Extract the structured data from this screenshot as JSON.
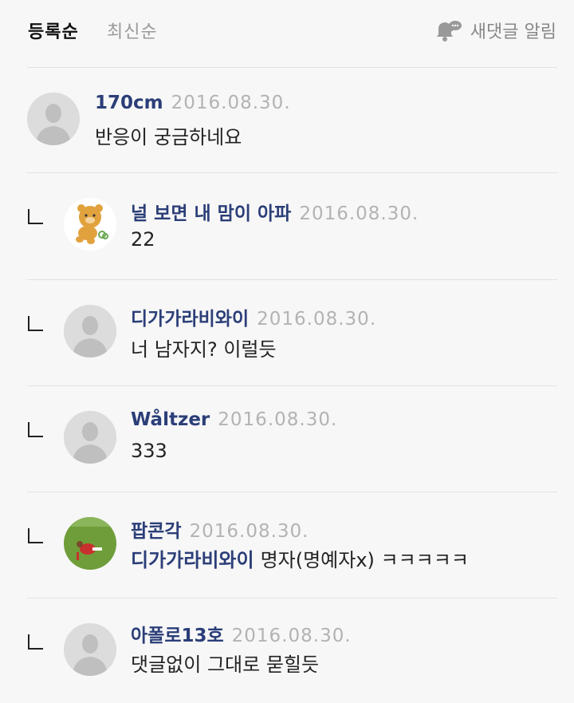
{
  "header": {
    "sort_registered": "등록순",
    "sort_latest": "최신순",
    "notify_label": "새댓글 알림",
    "notify_icon": "bell-chat-icon"
  },
  "comments": [
    {
      "name": "170cm",
      "date": "2016.08.30.",
      "text": "반응이 궁금하네요",
      "reply": false,
      "avatar": "default"
    },
    {
      "name": "널 보면 내 맘이 아파",
      "date": "2016.08.30.",
      "text": "22",
      "reply": true,
      "avatar": "bear"
    },
    {
      "name": "디가가라비와이",
      "date": "2016.08.30.",
      "text": "너 남자지? 이럴듯",
      "reply": true,
      "avatar": "default"
    },
    {
      "name": "Wåltzer",
      "date": "2016.08.30.",
      "text": "333",
      "reply": true,
      "avatar": "default"
    },
    {
      "name": "팝콘각",
      "date": "2016.08.30.",
      "mention": "디가가라비와이",
      "text": "명자(명예자x) ㅋㅋㅋㅋㅋ",
      "reply": true,
      "avatar": "soccer"
    },
    {
      "name": "아폴로13호",
      "date": "2016.08.30.",
      "text": "댓글없이 그대로 묻힐듯",
      "reply": true,
      "avatar": "default"
    }
  ]
}
